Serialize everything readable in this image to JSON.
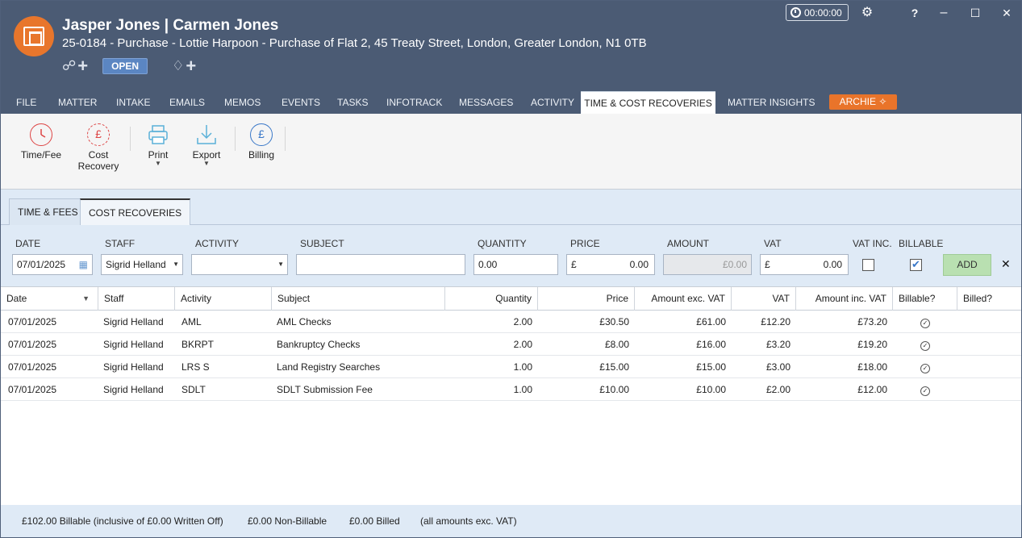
{
  "header": {
    "title": "Jasper Jones | Carmen Jones",
    "subtitle": "25-0184 - Purchase - Lottie Harpoon - Purchase of Flat 2, 45 Treaty Street, London, Greater London, N1 0TB",
    "status": "OPEN",
    "timer": "00:00:00"
  },
  "window_controls": {
    "settings": "⚙",
    "help": "?",
    "minimize": "–",
    "maximize": "☐",
    "close": "✕"
  },
  "tabs": [
    {
      "label": "FILE"
    },
    {
      "label": "MATTER"
    },
    {
      "label": "INTAKE"
    },
    {
      "label": "EMAILS"
    },
    {
      "label": "MEMOS"
    },
    {
      "label": "EVENTS"
    },
    {
      "label": "TASKS"
    },
    {
      "label": "INFOTRACK"
    },
    {
      "label": "MESSAGES"
    },
    {
      "label": "ACTIVITY"
    },
    {
      "label": "TIME & COST RECOVERIES",
      "active": true
    },
    {
      "label": "MATTER INSIGHTS"
    }
  ],
  "archie": {
    "label": "ARCHIE"
  },
  "ribbon": {
    "time_fee": "Time/Fee",
    "cost_recovery_line1": "Cost",
    "cost_recovery_line2": "Recovery",
    "print": "Print",
    "export": "Export",
    "billing": "Billing"
  },
  "subtabs": {
    "time_fees": "TIME & FEES",
    "cost_recoveries": "COST RECOVERIES"
  },
  "form": {
    "labels": {
      "date": "DATE",
      "staff": "STAFF",
      "activity": "ACTIVITY",
      "subject": "SUBJECT",
      "quantity": "QUANTITY",
      "price": "PRICE",
      "amount": "AMOUNT",
      "vat": "VAT",
      "vat_inc": "VAT INC.",
      "billable": "BILLABLE"
    },
    "date_value": "07/01/2025",
    "staff_value": "Sigrid Helland",
    "activity_value": "",
    "subject_value": "",
    "quantity_value": "0.00",
    "currency": "£",
    "price_value": "0.00",
    "amount_value": "£0.00",
    "vat_value": "0.00",
    "vat_inc_checked": false,
    "billable_checked": true,
    "add_label": "ADD",
    "close_label": "✕"
  },
  "table": {
    "columns": {
      "date": "Date",
      "staff": "Staff",
      "activity": "Activity",
      "subject": "Subject",
      "quantity": "Quantity",
      "price": "Price",
      "amount_exc": "Amount exc. VAT",
      "vat": "VAT",
      "amount_inc": "Amount inc. VAT",
      "billable": "Billable?",
      "billed": "Billed?"
    },
    "rows": [
      {
        "date": "07/01/2025",
        "staff": "Sigrid Helland",
        "activity": "AML",
        "subject": "AML Checks",
        "quantity": "2.00",
        "price": "£30.50",
        "amount_exc": "£61.00",
        "vat": "£12.20",
        "amount_inc": "£73.20"
      },
      {
        "date": "07/01/2025",
        "staff": "Sigrid Helland",
        "activity": "BKRPT",
        "subject": "Bankruptcy Checks",
        "quantity": "2.00",
        "price": "£8.00",
        "amount_exc": "£16.00",
        "vat": "£3.20",
        "amount_inc": "£19.20"
      },
      {
        "date": "07/01/2025",
        "staff": "Sigrid Helland",
        "activity": "LRS S",
        "subject": "Land Registry Searches",
        "quantity": "1.00",
        "price": "£15.00",
        "amount_exc": "£15.00",
        "vat": "£3.00",
        "amount_inc": "£18.00"
      },
      {
        "date": "07/01/2025",
        "staff": "Sigrid Helland",
        "activity": "SDLT",
        "subject": "SDLT Submission Fee",
        "quantity": "1.00",
        "price": "£10.00",
        "amount_exc": "£10.00",
        "vat": "£2.00",
        "amount_inc": "£12.00"
      }
    ]
  },
  "footer": {
    "billable": "£102.00 Billable (inclusive of £0.00 Written Off)",
    "non_billable": "£0.00 Non-Billable",
    "billed": "£0.00 Billed",
    "note": "(all amounts exc. VAT)"
  }
}
